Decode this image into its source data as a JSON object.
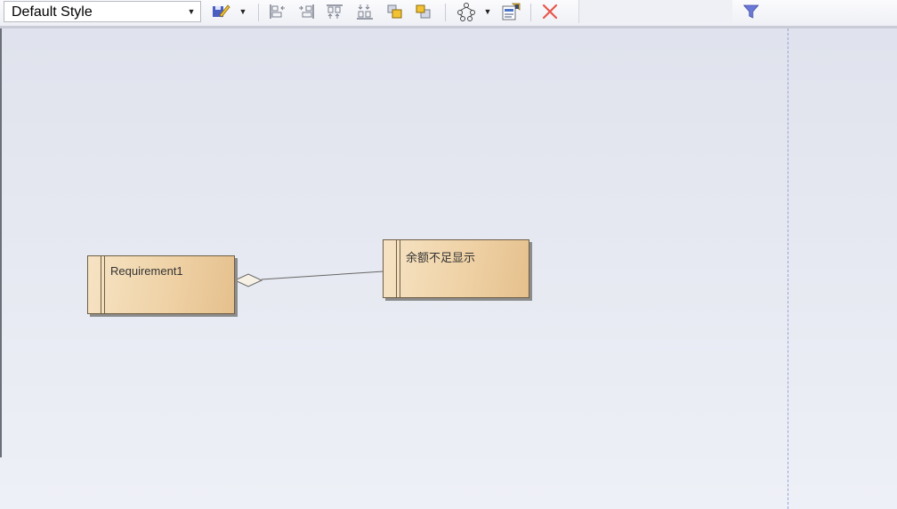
{
  "toolbar": {
    "style_value": "Default Style",
    "icons": [
      "dropdown-arrow",
      "save-style-icon",
      "align-left-icon",
      "align-right-icon",
      "align-top-icon",
      "align-bottom-icon",
      "bring-to-front-icon",
      "send-to-back-icon",
      "layout-icon",
      "properties-icon",
      "delete-icon",
      "filter-icon"
    ],
    "colors": {
      "delete": "#e8574a",
      "filter": "#6a78d8"
    }
  },
  "diagram": {
    "elements": [
      {
        "label": "Requirement1"
      },
      {
        "label": "余额不足显示"
      }
    ],
    "connector": "aggregation"
  }
}
